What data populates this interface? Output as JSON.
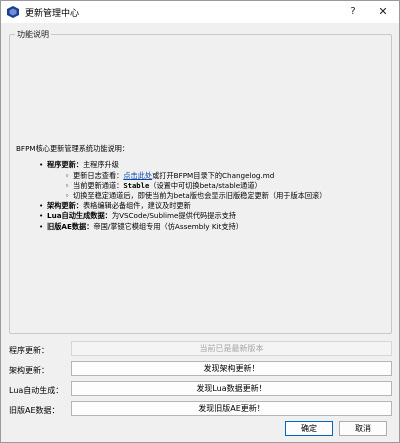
{
  "window": {
    "title": "更新管理中心",
    "help_label": "?",
    "close_label": "✕"
  },
  "group": {
    "title": "功能说明",
    "intro": "BFPM核心更新管理系统功能说明：",
    "items": [
      {
        "bold": "程序更新：",
        "text": "主程序升级",
        "subitems": [
          {
            "before": "更新日志查看：",
            "link": "点击此处",
            "after": "或打开BFPM目录下的Changelog.md"
          },
          {
            "before": "当前更新通道：",
            "mono": "Stable",
            "after": "（设置中可切换beta/stable通道）"
          },
          {
            "text": "切换至稳定通道后，即使当前为beta版也会显示旧版稳定更新（用于版本回滚）"
          }
        ]
      },
      {
        "bold": "架构更新：",
        "text": "表格编辑必备组件，建议及时更新"
      },
      {
        "bold": "Lua自动生成数据：",
        "text": "为VSCode/Sublime提供代码提示支持"
      },
      {
        "bold": "旧版AE数据：",
        "text": "帝国/掌镜它模组专用（仿Assembly Kit支持）"
      }
    ]
  },
  "rows": {
    "program": {
      "label": "程序更新：",
      "button": "当前已是最新版本"
    },
    "arch": {
      "label": "架构更新：",
      "button": "发现架构更新！"
    },
    "lua": {
      "label": "Lua自动生成：",
      "button": "发现Lua数据更新！"
    },
    "ae": {
      "label": "旧版AE数据：",
      "button": "发现旧版AE更新！"
    }
  },
  "footer": {
    "ok": "确定",
    "cancel": "取消"
  },
  "colors": {
    "link": "#0645ad",
    "icon": "#1a3f8f",
    "ok_border": "#0067c0"
  }
}
